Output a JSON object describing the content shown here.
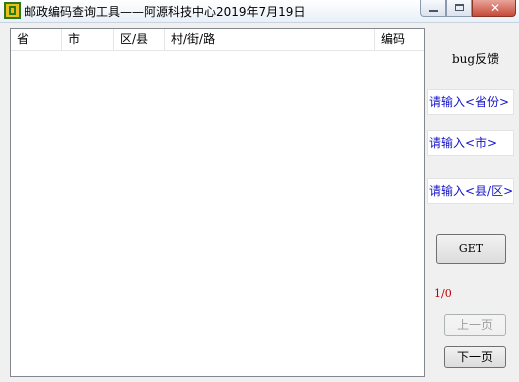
{
  "window": {
    "title": "邮政编码查询工具——阿源科技中心2019年7月19日",
    "close_glyph": "✕"
  },
  "table": {
    "columns": [
      "省",
      "市",
      "区/县",
      "村/街/路",
      "编码"
    ]
  },
  "side": {
    "feedback_label": "bug反馈",
    "province_input": "请输入<省份>",
    "city_input": "请输入<市>",
    "county_input": "请输入<县/区>",
    "get_button": "GET",
    "page_indicator": "1/0",
    "prev_button": "上一页",
    "next_button": "下一页"
  }
}
